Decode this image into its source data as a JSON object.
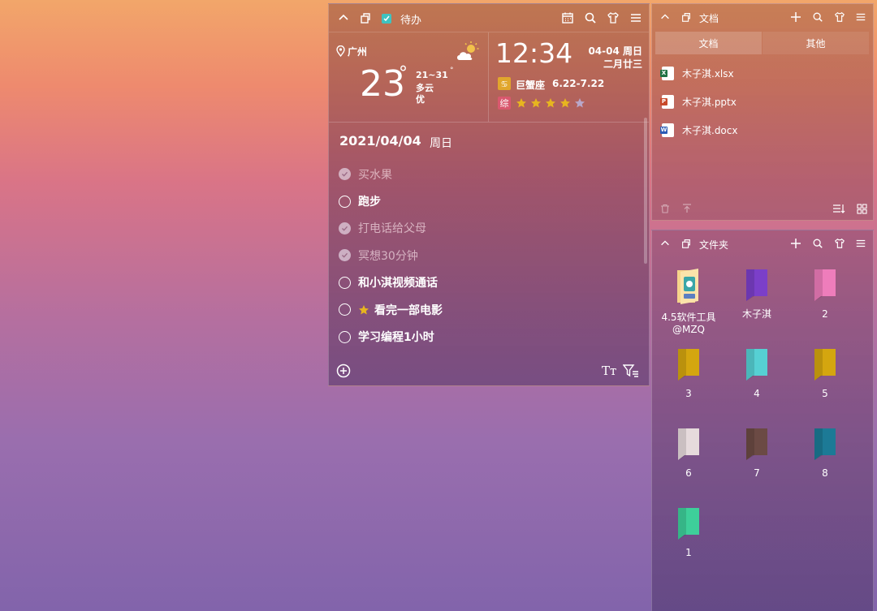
{
  "todo": {
    "title": "待办",
    "weather": {
      "city": "广州",
      "temp": "23",
      "degree": "°",
      "range": "21~31",
      "range_degree": "°",
      "condition": "多云",
      "air": "优"
    },
    "clock": {
      "time": "12:34",
      "date_weekday": "04-04 周日",
      "lunar": "二月廿三",
      "zodiac_name": "巨蟹座",
      "zodiac_dates": "6.22-7.22",
      "rating_badge": "综",
      "rating": 4,
      "rating_max": 5
    },
    "date_header": "2021/04/04",
    "weekday": "周日",
    "items": [
      {
        "label": "买水果",
        "done": true,
        "star": false
      },
      {
        "label": "跑步",
        "done": false,
        "star": false
      },
      {
        "label": "打电话给父母",
        "done": true,
        "star": false
      },
      {
        "label": "冥想30分钟",
        "done": true,
        "star": false
      },
      {
        "label": "和小淇视频通话",
        "done": false,
        "star": false
      },
      {
        "label": "看完一部电影",
        "done": false,
        "star": true
      },
      {
        "label": "学习编程1小时",
        "done": false,
        "star": false
      }
    ],
    "font_icon_label": "Tт"
  },
  "docs": {
    "title": "文档",
    "tabs": [
      "文档",
      "其他"
    ],
    "files": [
      {
        "name": "木子淇.xlsx",
        "type": "xlsx",
        "tag": "X",
        "color": "#1f7244"
      },
      {
        "name": "木子淇.pptx",
        "type": "pptx",
        "tag": "P",
        "color": "#c84a2b"
      },
      {
        "name": "木子淇.docx",
        "type": "docx",
        "tag": "W",
        "color": "#2b5bb5"
      }
    ]
  },
  "folders": {
    "title": "文件夹",
    "items": [
      {
        "label": "4.5软件工具@MZQ",
        "color": "#f0c060",
        "special": true
      },
      {
        "label": "木子淇",
        "color": "#7b3fc9"
      },
      {
        "label": "2",
        "color": "#ee7dbb"
      },
      {
        "label": "3",
        "color": "#d4a60f"
      },
      {
        "label": "4",
        "color": "#56d0d3"
      },
      {
        "label": "5",
        "color": "#d4a60f"
      },
      {
        "label": "6",
        "color": "#e6dadc"
      },
      {
        "label": "7",
        "color": "#6b4a44"
      },
      {
        "label": "8",
        "color": "#1c7a96"
      },
      {
        "label": "1",
        "color": "#3ecf9a"
      }
    ]
  },
  "colors": {
    "star": "#e7b51f",
    "star_empty": "#b9a7c9"
  }
}
